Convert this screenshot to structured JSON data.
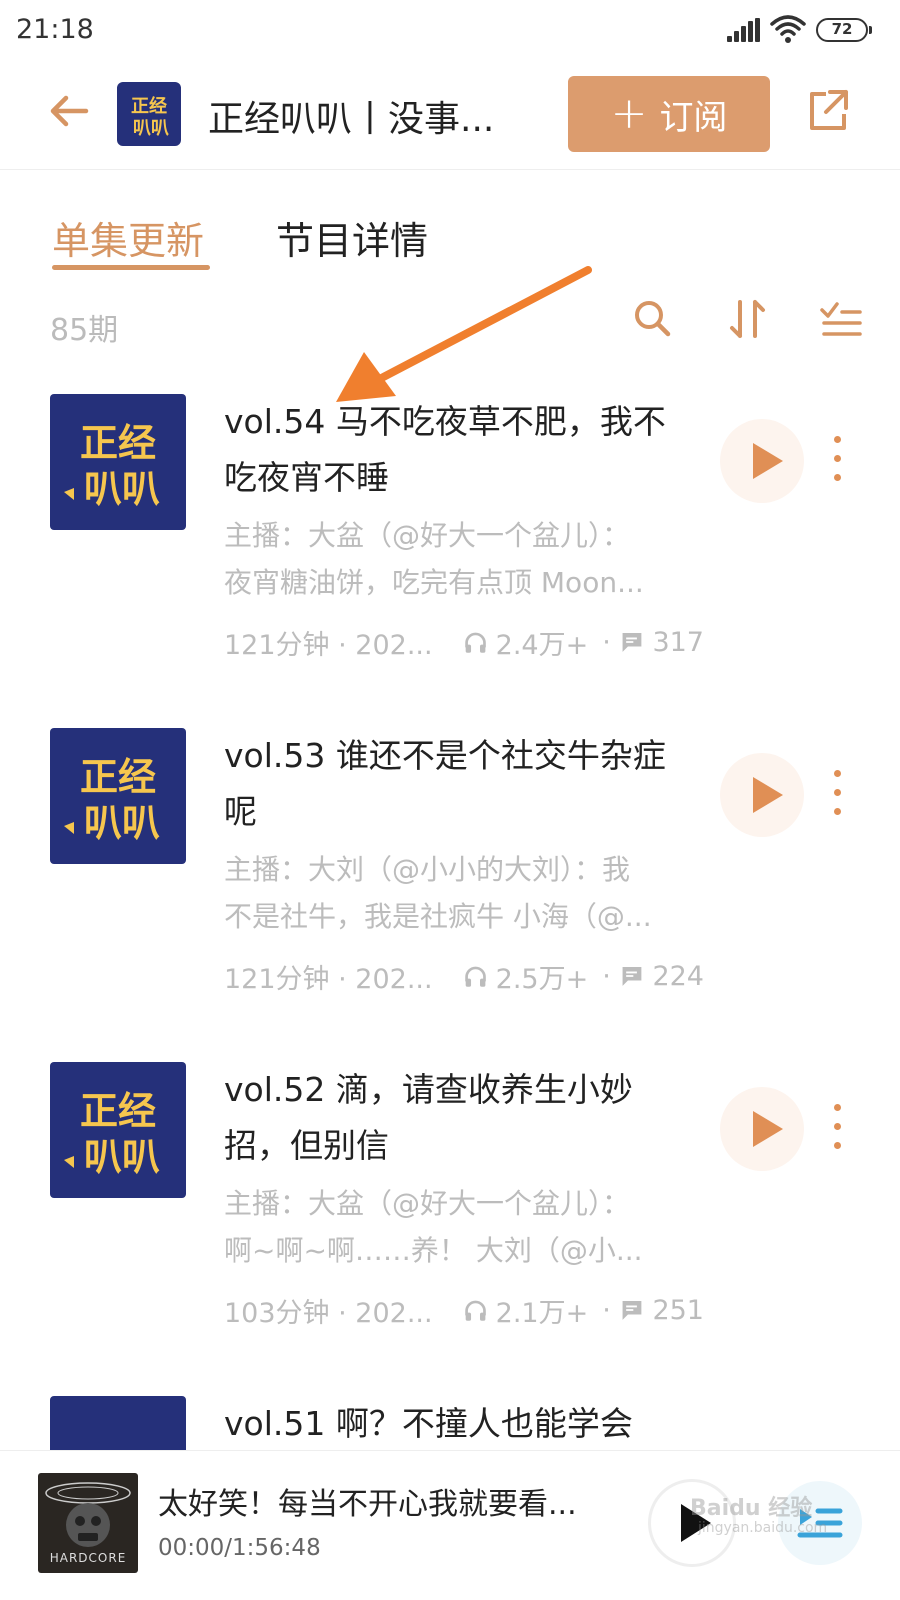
{
  "status_bar": {
    "time": "21:18",
    "battery": "72"
  },
  "header": {
    "title": "正经叭叭丨没事...",
    "subscribe_label": "订阅",
    "cover_text_top": "正经",
    "cover_text_bottom": "叭叭"
  },
  "tabs": [
    {
      "label": "单集更新"
    },
    {
      "label": "节目详情"
    }
  ],
  "toolbar": {
    "episode_count": "85期"
  },
  "episodes": [
    {
      "title": "vol.54 马不吃夜草不肥，我不吃夜宵不睡",
      "desc_line1": "主播：大盆（@好大一个盆儿）：",
      "desc_line2": "夜宵糖油饼，吃完有点顶 Moon...",
      "duration": "121分钟 · 202...",
      "plays": "2.4万+",
      "comments": "317"
    },
    {
      "title": "vol.53 谁还不是个社交牛杂症呢",
      "desc_line1": "主播：大刘（@小小的大刘）：我",
      "desc_line2": "不是社牛，我是社疯牛 小海（@...",
      "duration": "121分钟 · 202...",
      "plays": "2.5万+",
      "comments": "224"
    },
    {
      "title": "vol.52 滴，请查收养生小妙招，但别信",
      "desc_line1": "主播：大盆（@好大一个盆儿）：",
      "desc_line2": "啊~啊~啊……养！ 大刘（@小...",
      "duration": "103分钟 · 202...",
      "plays": "2.1万+",
      "comments": "251"
    },
    {
      "title": "vol.51 啊？不撞人也能学会",
      "desc_line1": "",
      "desc_line2": "",
      "duration": "",
      "plays": "",
      "comments": ""
    }
  ],
  "player": {
    "title": "太好笑！每当不开心我就要看...",
    "time": "00:00/1:56:48",
    "cover_text": "HARDCORE"
  },
  "watermark": {
    "line1": "Baidu 经验",
    "line2": "jingyan.baidu.com"
  },
  "colors": {
    "accent": "#d69563",
    "cover_bg": "#25307a",
    "cover_text": "#f6c64e"
  }
}
